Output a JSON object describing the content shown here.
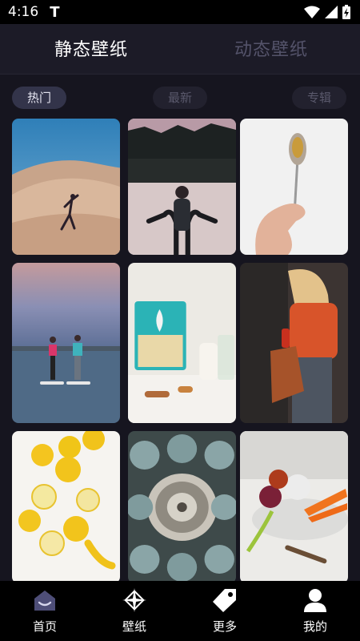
{
  "status_bar": {
    "time": "4:16",
    "carrier_icon": "T"
  },
  "top_tabs": [
    {
      "label": "静态壁纸",
      "active": true
    },
    {
      "label": "动态壁纸",
      "active": false
    }
  ],
  "categories": [
    {
      "label": "热门",
      "active": true
    },
    {
      "label": "最新",
      "active": false
    },
    {
      "label": "专辑",
      "active": false
    }
  ],
  "wallpapers": [
    {
      "subject": "dancer-on-sand-dunes"
    },
    {
      "subject": "woman-by-mountain-lake"
    },
    {
      "subject": "hand-holding-spoon-with-gem"
    },
    {
      "subject": "paddle-boarders-at-sunset"
    },
    {
      "subject": "health-food-pouch-on-table"
    },
    {
      "subject": "woman-with-leather-bag"
    },
    {
      "subject": "lemons-flat-lay"
    },
    {
      "subject": "masked-people-circle"
    },
    {
      "subject": "vegetables-in-bowl"
    }
  ],
  "bottom_nav": [
    {
      "label": "首页",
      "icon": "home-icon",
      "active": true
    },
    {
      "label": "壁纸",
      "icon": "wallpaper-icon",
      "active": false
    },
    {
      "label": "更多",
      "icon": "tag-icon",
      "active": false
    },
    {
      "label": "我的",
      "icon": "user-icon",
      "active": false
    }
  ],
  "colors": {
    "background": "#16151f",
    "nav_active": "#4e4e78",
    "text_inactive": "#54536a"
  }
}
